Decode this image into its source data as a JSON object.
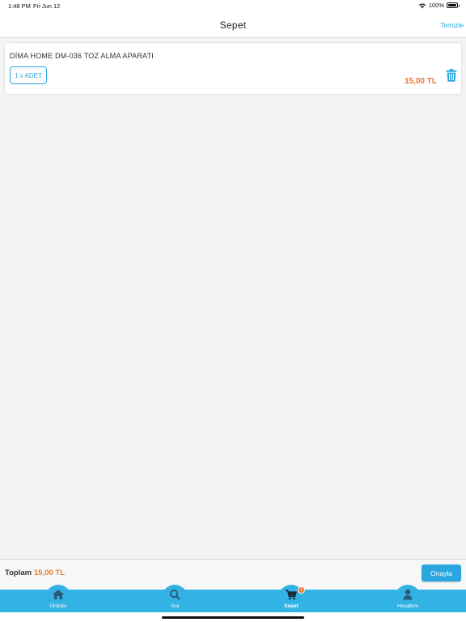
{
  "status_bar": {
    "time": "1:48 PM",
    "date": "Fri Jun 12",
    "battery": "100%"
  },
  "nav": {
    "title": "Sepet",
    "action": "Temizle"
  },
  "cart": {
    "items": [
      {
        "name": "DİMA HOME DM-036 TOZ ALMA APARATI",
        "quantity": "1 x ADET",
        "price": "15,00 TL"
      }
    ]
  },
  "summary": {
    "total_label": "Toplam",
    "total_value": "15,00 TL",
    "confirm_label": "Onayla"
  },
  "tabs": [
    {
      "label": "Ürünler",
      "icon": "home-icon"
    },
    {
      "label": "Ara",
      "icon": "search-icon"
    },
    {
      "label": "Sepet",
      "icon": "cart-icon",
      "badge": "1",
      "active": true
    },
    {
      "label": "Hesabım",
      "icon": "user-icon"
    }
  ],
  "colors": {
    "accent": "#2aa7df",
    "tab_bar": "#33b2e6",
    "price": "#e8772e"
  }
}
